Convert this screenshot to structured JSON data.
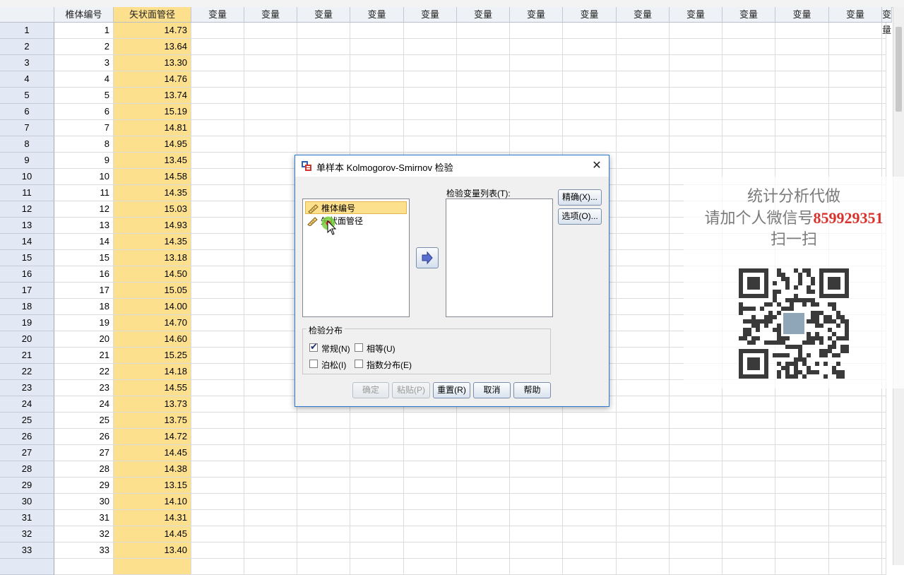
{
  "columns": {
    "row_header": "",
    "headers": [
      "椎体编号",
      "矢状面管径",
      "变量",
      "变量",
      "变量",
      "变量",
      "变量",
      "变量",
      "变量",
      "变量",
      "变量",
      "变量",
      "变量",
      "变量",
      "变量",
      "变量"
    ]
  },
  "rows": [
    {
      "n": "1",
      "id": "1",
      "val": "14.73"
    },
    {
      "n": "2",
      "id": "2",
      "val": "13.64"
    },
    {
      "n": "3",
      "id": "3",
      "val": "13.30"
    },
    {
      "n": "4",
      "id": "4",
      "val": "14.76"
    },
    {
      "n": "5",
      "id": "5",
      "val": "13.74"
    },
    {
      "n": "6",
      "id": "6",
      "val": "15.19"
    },
    {
      "n": "7",
      "id": "7",
      "val": "14.81"
    },
    {
      "n": "8",
      "id": "8",
      "val": "14.95"
    },
    {
      "n": "9",
      "id": "9",
      "val": "13.45"
    },
    {
      "n": "10",
      "id": "10",
      "val": "14.58"
    },
    {
      "n": "11",
      "id": "11",
      "val": "14.35"
    },
    {
      "n": "12",
      "id": "12",
      "val": "15.03"
    },
    {
      "n": "13",
      "id": "13",
      "val": "14.93"
    },
    {
      "n": "14",
      "id": "14",
      "val": "14.35"
    },
    {
      "n": "15",
      "id": "15",
      "val": "13.18"
    },
    {
      "n": "16",
      "id": "16",
      "val": "14.50"
    },
    {
      "n": "17",
      "id": "17",
      "val": "15.05"
    },
    {
      "n": "18",
      "id": "18",
      "val": "14.00"
    },
    {
      "n": "19",
      "id": "19",
      "val": "14.70"
    },
    {
      "n": "20",
      "id": "20",
      "val": "14.60"
    },
    {
      "n": "21",
      "id": "21",
      "val": "15.25"
    },
    {
      "n": "22",
      "id": "22",
      "val": "14.18"
    },
    {
      "n": "23",
      "id": "23",
      "val": "14.55"
    },
    {
      "n": "24",
      "id": "24",
      "val": "13.73"
    },
    {
      "n": "25",
      "id": "25",
      "val": "13.75"
    },
    {
      "n": "26",
      "id": "26",
      "val": "14.72"
    },
    {
      "n": "27",
      "id": "27",
      "val": "14.45"
    },
    {
      "n": "28",
      "id": "28",
      "val": "14.38"
    },
    {
      "n": "29",
      "id": "29",
      "val": "13.15"
    },
    {
      "n": "30",
      "id": "30",
      "val": "14.10"
    },
    {
      "n": "31",
      "id": "31",
      "val": "14.31"
    },
    {
      "n": "32",
      "id": "32",
      "val": "14.45"
    },
    {
      "n": "33",
      "id": "33",
      "val": "13.40"
    }
  ],
  "dialog": {
    "title": "单样本 Kolmogorov-Smirnov 检验",
    "close_glyph": "✕",
    "source_vars": [
      "椎体编号",
      "矢状面管径"
    ],
    "test_list_label": "检验变量列表(T):",
    "exact_button": "精确(X)...",
    "options_button": "选项(O)...",
    "group_label": "检验分布",
    "checks": [
      {
        "label": "常规(N)",
        "checked": true
      },
      {
        "label": "相等(U)",
        "checked": false
      },
      {
        "label": "泊松(I)",
        "checked": false
      },
      {
        "label": "指数分布(E)",
        "checked": false
      }
    ],
    "buttons": {
      "ok": "确定",
      "paste": "粘贴(P)",
      "reset": "重置(R)",
      "cancel": "取消",
      "help": "帮助"
    }
  },
  "watermark": {
    "line1": "统计分析代做",
    "line2_prefix": "请加个人微信号",
    "line2_number": "859929351",
    "line3": "扫一扫"
  },
  "colors": {
    "selected_column": "#fde08d",
    "dialog_border": "#2a79d3",
    "watermark_number": "#d9312c"
  }
}
